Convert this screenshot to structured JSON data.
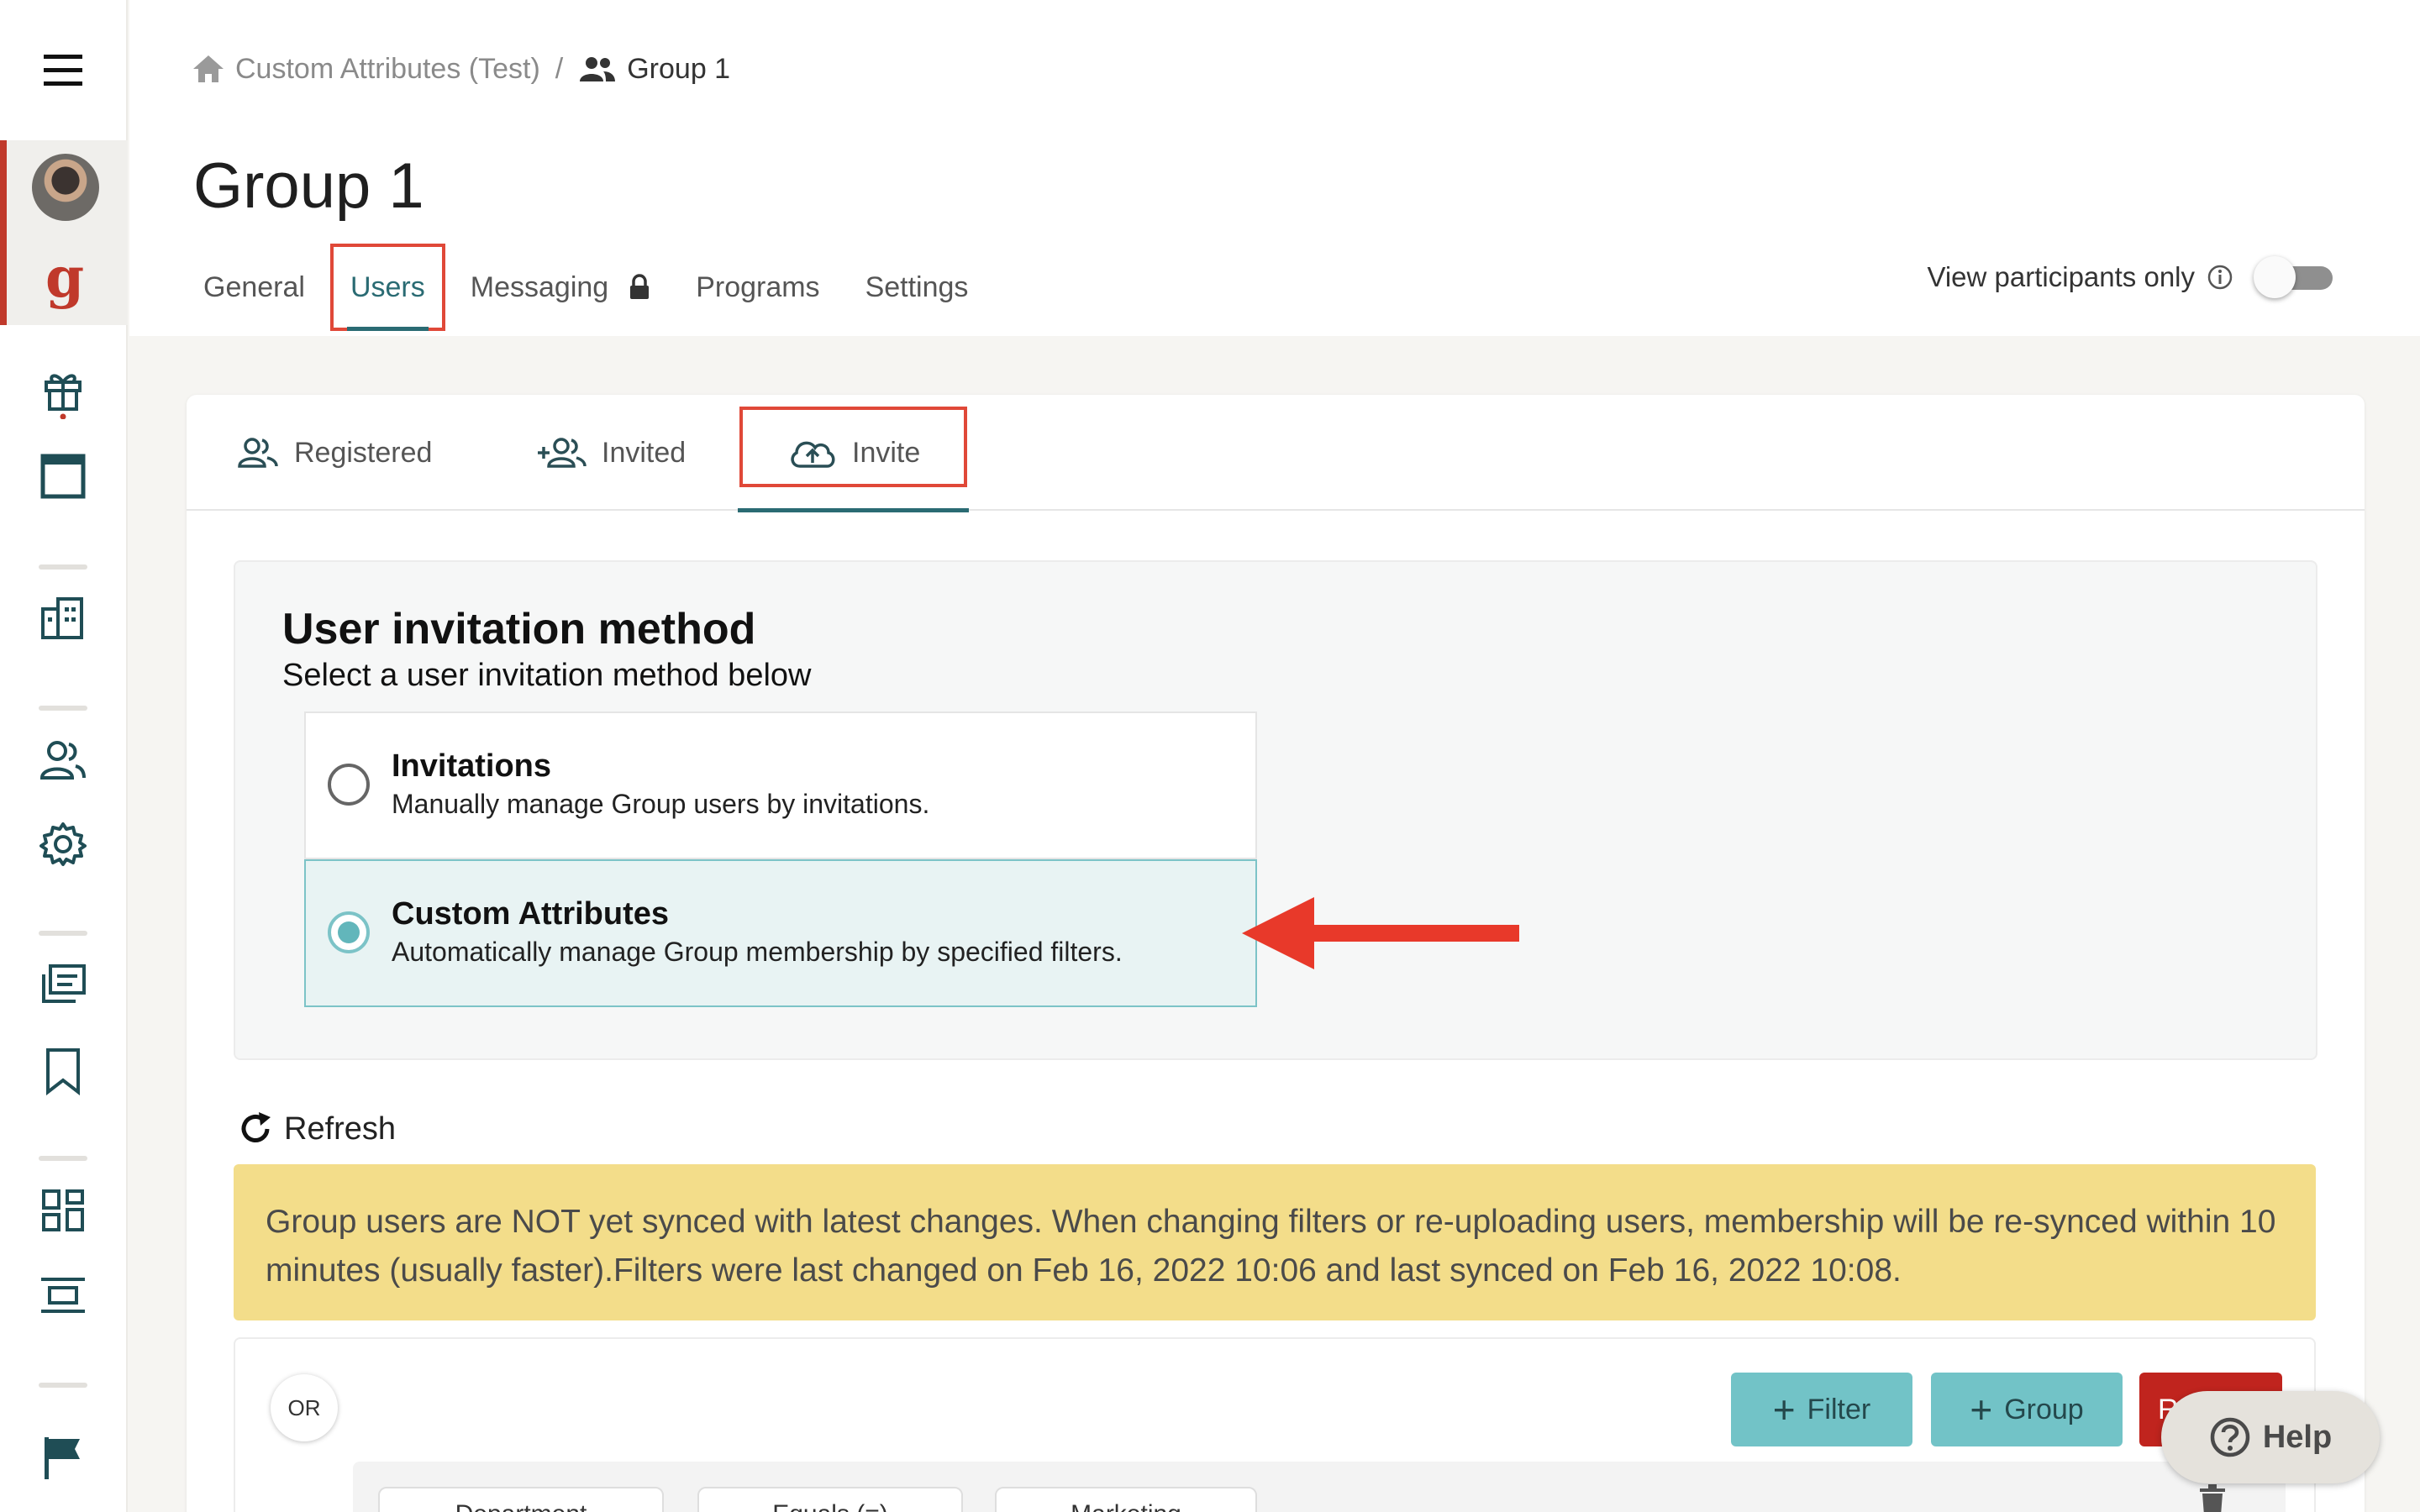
{
  "breadcrumb": {
    "home": "Custom Attributes (Test)",
    "separator": "/",
    "current": "Group 1"
  },
  "page": {
    "title": "Group 1"
  },
  "tabs": [
    {
      "label": "General"
    },
    {
      "label": "Users"
    },
    {
      "label": "Messaging"
    },
    {
      "label": "Programs"
    },
    {
      "label": "Settings"
    }
  ],
  "view_participants": {
    "label": "View participants only",
    "enabled": false
  },
  "subtabs": [
    {
      "label": "Registered"
    },
    {
      "label": "Invited"
    },
    {
      "label": "Invite"
    }
  ],
  "invitation": {
    "title": "User invitation method",
    "subtitle": "Select a user invitation method below",
    "options": [
      {
        "title": "Invitations",
        "desc": "Manually manage Group users by invitations.",
        "selected": false
      },
      {
        "title": "Custom Attributes",
        "desc": "Automatically manage Group membership by specified filters.",
        "selected": true
      }
    ]
  },
  "refresh_label": "Refresh",
  "banner": {
    "text": "Group users are NOT yet synced with latest changes. When changing filters or re-uploading users, membership will be re-synced within 10 minutes (usually faster).Filters were last changed on Feb 16, 2022 10:06 and last synced on Feb 16, 2022 10:08."
  },
  "filters": {
    "or_label": "OR",
    "filter_button": "Filter",
    "group_button": "Group",
    "remove_button": "R",
    "row": {
      "attribute": "Department",
      "operator": "Equals (=)",
      "value": "Marketing"
    }
  },
  "help_label": "Help",
  "colors": {
    "accent": "#2a6b73",
    "highlight": "#e04838",
    "banner": "#f3dd8a",
    "teal": "#72c3c7",
    "brand_red": "#c0392b"
  }
}
